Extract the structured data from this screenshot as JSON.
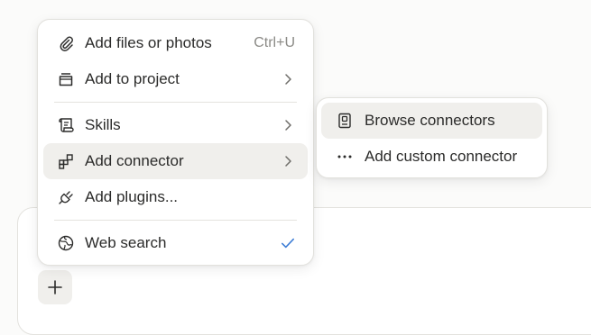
{
  "menu": {
    "items": [
      {
        "label": "Add files or photos",
        "shortcut": "Ctrl+U",
        "icon": "paperclip-icon"
      },
      {
        "label": "Add to project",
        "icon": "project-icon",
        "trailing": "chevron-right-icon"
      },
      {
        "label": "Skills",
        "icon": "scroll-icon",
        "trailing": "chevron-right-icon"
      },
      {
        "label": "Add connector",
        "icon": "connector-icon",
        "trailing": "chevron-right-icon"
      },
      {
        "label": "Add plugins...",
        "icon": "plug-icon"
      },
      {
        "label": "Web search",
        "icon": "globe-icon",
        "trailing": "check-icon",
        "checked": true
      }
    ]
  },
  "submenu": {
    "items": [
      {
        "label": "Browse connectors",
        "icon": "book-icon"
      },
      {
        "label": "Add custom connector",
        "icon": "more-dots-icon"
      }
    ]
  },
  "colors": {
    "check": "#3a7bd5",
    "text": "#2b2b2a",
    "muted": "#8b8a86"
  }
}
